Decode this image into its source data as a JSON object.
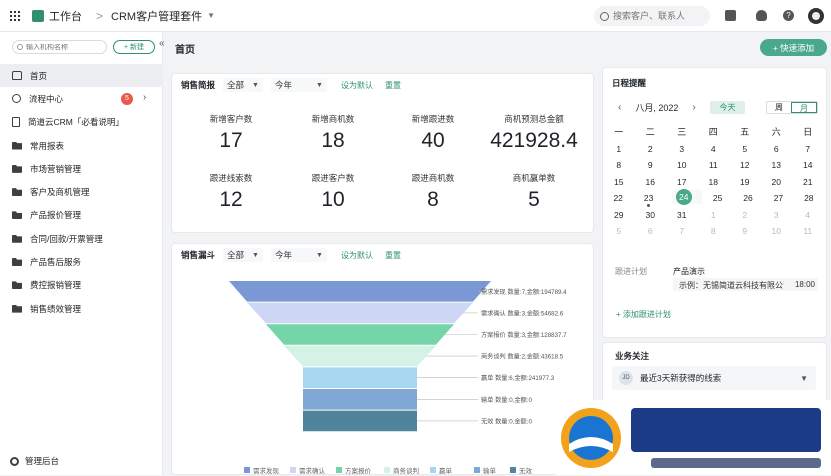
{
  "topbar": {
    "workspace": "工作台",
    "separator": ">",
    "app_name": "CRM客户管理套件",
    "search_placeholder": "搜索客户、联系人",
    "help": "?"
  },
  "sidebar": {
    "search_placeholder": "输入机构名称",
    "new_label": "+ 新建",
    "collapse": "«",
    "items": [
      {
        "label": "首页",
        "icon": "home-icon",
        "active": true
      },
      {
        "label": "流程中心",
        "icon": "flow-icon",
        "badge": "5",
        "chevron": "›"
      },
      {
        "label": "简道云CRM「必看说明」",
        "icon": "doc-icon"
      },
      {
        "label": "常用报表",
        "icon": "folder-icon"
      },
      {
        "label": "市场营销管理",
        "icon": "folder-icon"
      },
      {
        "label": "客户及商机管理",
        "icon": "folder-icon"
      },
      {
        "label": "产品报价管理",
        "icon": "folder-icon"
      },
      {
        "label": "合同/回款/开票管理",
        "icon": "folder-icon"
      },
      {
        "label": "产品售后服务",
        "icon": "folder-icon"
      },
      {
        "label": "费控报销管理",
        "icon": "folder-icon"
      },
      {
        "label": "销售绩效管理",
        "icon": "folder-icon"
      }
    ],
    "admin": "管理后台"
  },
  "main": {
    "page_title": "首页",
    "quick_add": "+ 快速添加"
  },
  "sales_brief": {
    "title": "销售简报",
    "scope": "全部",
    "period": "今年",
    "set_default": "设为默认",
    "reset": "重置",
    "stats": [
      {
        "label": "新增客户数",
        "value": "17"
      },
      {
        "label": "新增商机数",
        "value": "18"
      },
      {
        "label": "新增跟进数",
        "value": "40"
      },
      {
        "label": "商机预测总金额",
        "value": "421928.4"
      },
      {
        "label": "跟进线索数",
        "value": "12"
      },
      {
        "label": "跟进客户数",
        "value": "10"
      },
      {
        "label": "跟进商机数",
        "value": "8"
      },
      {
        "label": "商机赢单数",
        "value": "5"
      }
    ]
  },
  "funnel": {
    "title": "销售漏斗",
    "scope": "全部",
    "period": "今年",
    "set_default": "设为默认",
    "reset": "重置"
  },
  "chart_data": {
    "type": "funnel",
    "categories": [
      "需求发现",
      "需求确认",
      "方案报价",
      "商务谈判",
      "赢单",
      "输单",
      "无效"
    ],
    "counts": [
      7,
      3,
      3,
      2,
      6,
      0,
      0
    ],
    "amounts": [
      194789.4,
      54682.6,
      128837.7,
      43618.5,
      241977.3,
      0,
      0
    ],
    "labels": [
      "需求发现 数量:7,金额:194789.4",
      "需求确认 数量:3,金额:54682.6",
      "方案报价 数量:3,金额:128837.7",
      "商务谈判 数量:2,金额:43618.5",
      "赢单 数量:6,金额:241977.3",
      "输单 数量:0,金额:0",
      "无效 数量:0,金额:0"
    ],
    "colors": [
      "#7b97d6",
      "#cdd7f3",
      "#74d6a8",
      "#d4f2e6",
      "#a7d6f0",
      "#7fa8d4",
      "#4f849c"
    ],
    "legend_position": "bottom"
  },
  "schedule": {
    "title": "日程提醒",
    "month": "八月, 2022",
    "prev": "‹",
    "next": "›",
    "today": "今天",
    "view_week": "周",
    "view_month": "月",
    "weekdays": [
      "一",
      "二",
      "三",
      "四",
      "五",
      "六",
      "日"
    ],
    "weeks": [
      [
        "1",
        "2",
        "3",
        "4",
        "5",
        "6",
        "7"
      ],
      [
        "8",
        "9",
        "10",
        "11",
        "12",
        "13",
        "14"
      ],
      [
        "15",
        "16",
        "17",
        "18",
        "19",
        "20",
        "21"
      ],
      [
        "22",
        "23",
        "24",
        "25",
        "26",
        "27",
        "28"
      ],
      [
        "29",
        "30",
        "31",
        "1",
        "2",
        "3",
        "4"
      ],
      [
        "5",
        "6",
        "7",
        "8",
        "9",
        "10",
        "11"
      ]
    ],
    "selected_day": "24",
    "plan_label": "跟进计划",
    "plan_title": "产品演示",
    "plan_desc": "示例：无锡简道云科技有限公司",
    "plan_time": "18:00",
    "add_plan": "+ 添加跟进计划"
  },
  "business": {
    "title": "业务关注",
    "icon_text": "JD",
    "item": "最近3天新获得的线索"
  }
}
